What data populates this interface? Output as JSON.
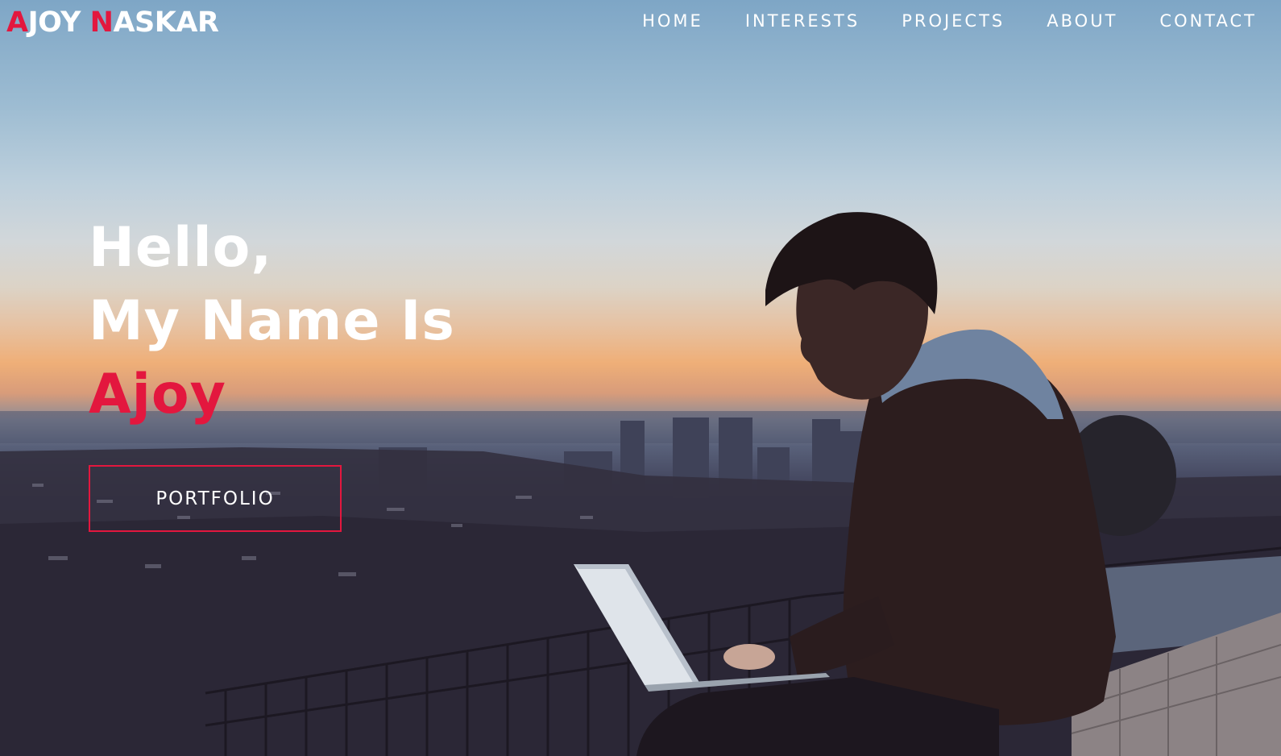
{
  "brand": {
    "first_initial": "A",
    "first_rest": "JOY ",
    "last_initial": "N",
    "last_rest": "ASKAR"
  },
  "nav": {
    "items": [
      {
        "label": "HOME"
      },
      {
        "label": "INTERESTS"
      },
      {
        "label": "PROJECTS"
      },
      {
        "label": "ABOUT"
      },
      {
        "label": "CONTACT"
      }
    ]
  },
  "hero": {
    "line1": "Hello,",
    "line2": "My Name Is",
    "name": "Ajoy",
    "button_label": "PORTFOLIO"
  },
  "colors": {
    "accent": "#e3173e",
    "text": "#ffffff"
  }
}
